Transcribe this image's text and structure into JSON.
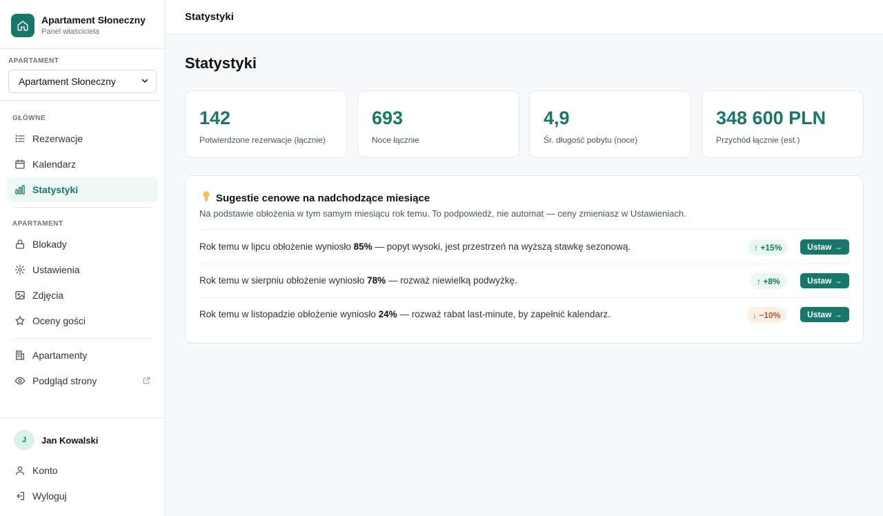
{
  "brand": {
    "title": "Apartament Słoneczny",
    "subtitle": "Panel właściciela"
  },
  "apartment_select": {
    "label": "APARTAMENT",
    "value": "Apartament Słoneczny"
  },
  "nav": {
    "main_label": "GŁÓWNE",
    "main": [
      {
        "label": "Rezerwacje",
        "icon": "list-icon"
      },
      {
        "label": "Kalendarz",
        "icon": "calendar-icon"
      },
      {
        "label": "Statystyki",
        "icon": "bar-chart-icon",
        "active": true
      }
    ],
    "apt_label": "APARTAMENT",
    "apartment": [
      {
        "label": "Blokady",
        "icon": "lock-icon"
      },
      {
        "label": "Ustawienia",
        "icon": "gear-icon"
      },
      {
        "label": "Zdjęcia",
        "icon": "image-icon"
      },
      {
        "label": "Oceny gości",
        "icon": "star-icon"
      }
    ],
    "extra": [
      {
        "label": "Apartamenty",
        "icon": "building-icon"
      },
      {
        "label": "Podgląd strony",
        "icon": "eye-icon"
      }
    ]
  },
  "user": {
    "initial": "J",
    "name": "Jan Kowalski"
  },
  "account": [
    {
      "label": "Konto",
      "icon": "user-icon"
    },
    {
      "label": "Wyloguj",
      "icon": "logout-icon"
    }
  ],
  "topbar": {
    "title": "Statystyki"
  },
  "page": {
    "title": "Statystyki"
  },
  "stats": [
    {
      "value": "142",
      "label": "Potwierdzone rezerwacje (łącznie)"
    },
    {
      "value": "693",
      "label": "Noce łącznie"
    },
    {
      "value": "4,9",
      "label": "Śr. długość pobytu (noce)"
    },
    {
      "value": "348 600 PLN",
      "label": "Przychód łącznie (est.)"
    }
  ],
  "pricing": {
    "icon": "lightbulb-icon",
    "title": "Sugestie cenowe na nadchodzące miesiące",
    "subtitle": "Na podstawie obłożenia w tym samym miesiącu rok temu. To podpowiedź, nie automat — ceny zmieniasz w Ustawieniach.",
    "rows": [
      {
        "prefix": "Rok temu w lipcu obłożenie wyniosło",
        "pct": "85%",
        "suffix": "— popyt wysoki, jest przestrzeń na wyższą stawkę sezonową.",
        "change": "↑ +15%",
        "direction": "up",
        "button": "Ustaw →"
      },
      {
        "prefix": "Rok temu w sierpniu obłożenie wyniosło",
        "pct": "78%",
        "suffix": "— rozważ niewielką podwyżkę.",
        "change": "↑ +8%",
        "direction": "up",
        "button": "Ustaw →"
      },
      {
        "prefix": "Rok temu w listopadzie obłożenie wyniosło",
        "pct": "24%",
        "suffix": "— rozważ rabat last-minute, by zapełnić kalendarz.",
        "change": "↓ −10%",
        "direction": "down",
        "button": "Ustaw →"
      }
    ]
  },
  "colors": {
    "accent": "#17776a",
    "up": "#167a52",
    "down": "#c2541d"
  }
}
